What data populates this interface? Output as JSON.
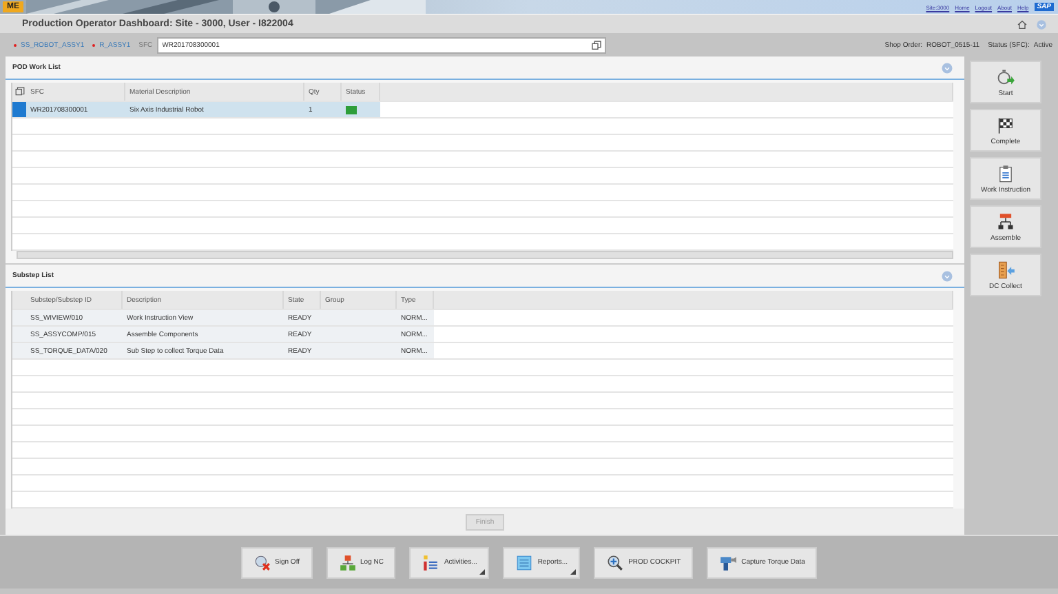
{
  "banner": {
    "logo": "ME",
    "links": [
      "Site:3000",
      "Home",
      "Logout",
      "About",
      "Help"
    ],
    "brand": "SAP"
  },
  "title": "Production Operator Dashboard: Site - 3000, User - I822004",
  "sfc_bar": {
    "resources": [
      "SS_ROBOT_ASSY1",
      "R_ASSY1"
    ],
    "sfc_label": "SFC",
    "sfc_value": "WR201708300001",
    "info": [
      {
        "label": "Shop Order:",
        "value": "ROBOT_0515-11"
      },
      {
        "label": "Status (SFC):",
        "value": "Active"
      }
    ]
  },
  "work_list": {
    "title": "POD Work List",
    "columns": [
      "SFC",
      "Material Description",
      "Qty",
      "Status"
    ],
    "rows": [
      {
        "cells": [
          "WR201708300001",
          "Six Axis Industrial Robot",
          "1"
        ],
        "color": "#2e9e3a",
        "selected": true
      }
    ]
  },
  "substep_list": {
    "title": "Substep List",
    "columns": [
      "Substep/Substep ID",
      "Description",
      "State",
      "Group",
      "Type"
    ],
    "rows": [
      {
        "cells": [
          "SS_WIVIEW/010",
          "Work Instruction View",
          "READY",
          "",
          "NORM..."
        ],
        "selected": false
      },
      {
        "cells": [
          "SS_ASSYCOMP/015",
          "Assemble Components",
          "READY",
          "",
          "NORM..."
        ],
        "selected": false
      },
      {
        "cells": [
          "SS_TORQUE_DATA/020",
          "Sub Step to collect Torque Data",
          "READY",
          "",
          "NORM..."
        ],
        "selected": false
      }
    ],
    "finish": {
      "label": "Finish",
      "disabled": true
    }
  },
  "side_buttons": [
    {
      "kind": "start",
      "label": "Start"
    },
    {
      "kind": "complete",
      "label": "Complete"
    },
    {
      "kind": "instruction",
      "label": "Work Instruction"
    },
    {
      "kind": "assemble",
      "label": "Assemble"
    },
    {
      "kind": "collect",
      "label": "DC Collect"
    }
  ],
  "bottom_buttons": [
    {
      "kind": "signoff",
      "label": "Sign Off",
      "menu": false
    },
    {
      "kind": "lognc",
      "label": "Log NC",
      "menu": false
    },
    {
      "kind": "activities",
      "label": "Activities...",
      "menu": true
    },
    {
      "kind": "reports",
      "label": "Reports...",
      "menu": true
    },
    {
      "kind": "cockpit",
      "label": "PROD COCKPIT",
      "menu": false
    },
    {
      "kind": "torque",
      "label": "Capture Torque Data",
      "menu": false
    }
  ]
}
